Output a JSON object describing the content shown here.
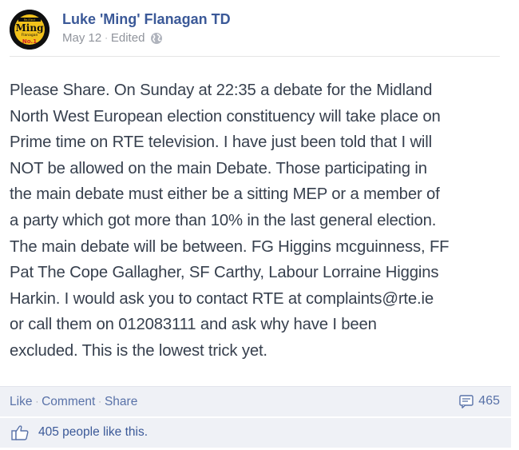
{
  "post": {
    "author": "Luke 'Ming' Flanagan TD",
    "avatar": {
      "badge_lines": [
        "Re-Elect",
        "Ming",
        "Flanagan",
        "No.1"
      ],
      "colors": {
        "ring": "#0f0f0f",
        "inner": "#f2c21b",
        "text": "#111111",
        "accent": "#d11f26"
      }
    },
    "date": "May 12",
    "edited_label": "Edited",
    "privacy_icon": "globe-icon",
    "text_lines": [
      "Please Share. On Sunday at 22:35 a debate for the Midland",
      "North West European election constituency will take place on",
      "Prime time on RTE television. I have just been told that I will",
      "NOT be allowed on the main Debate. Those participating in",
      "the main debate must either be a sitting MEP or a member of",
      "a party which got more than 10% in the last general election.",
      "The main debate will be between. FG Higgins mcguinness, FF",
      "Pat The Cope Gallagher, SF Carthy, Labour Lorraine Higgins",
      "Harkin. I would ask you to contact RTE at complaints@rte.ie",
      "or call them on 012083111 and ask why have I been",
      "excluded. This is the lowest trick yet."
    ]
  },
  "actions": {
    "like": "Like",
    "comment": "Comment",
    "share": "Share",
    "separator": "·",
    "comments_icon": "comment-icon",
    "comments_count": "465"
  },
  "likes": {
    "icon": "thumbs-up-icon",
    "text": "405 people like this."
  },
  "colors": {
    "link": "#3b5998",
    "meta": "#90949c",
    "bar_bg": "#eff1f6"
  }
}
